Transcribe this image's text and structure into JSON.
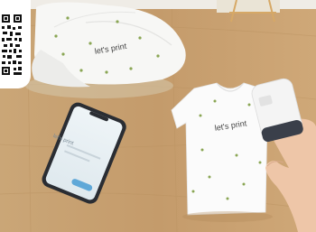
{
  "cap_print": "let's print",
  "shirt_print": "let's print",
  "phone_screen_text": "let's print",
  "colors": {
    "table": "#c9a274",
    "shirt": "#fbfbfb",
    "stars": "#8aa654",
    "phone_button": "#5fa8d8",
    "printer_dark": "#3a3f4a"
  },
  "icons": [
    "qr-code-icon"
  ]
}
